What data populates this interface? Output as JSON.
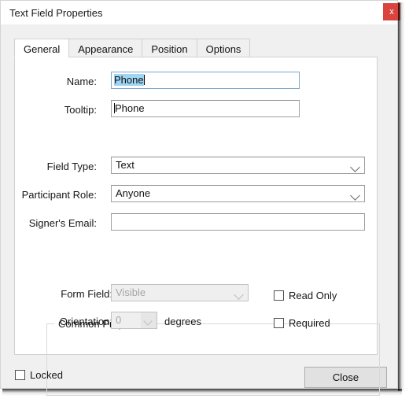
{
  "window": {
    "title": "Text Field Properties",
    "close_icon_label": "x",
    "close_icon_name": "close-icon",
    "accent_close_color": "#d9443f"
  },
  "tabs": [
    {
      "label": "General",
      "active": true
    },
    {
      "label": "Appearance",
      "active": false
    },
    {
      "label": "Position",
      "active": false
    },
    {
      "label": "Options",
      "active": false
    }
  ],
  "general": {
    "name_label": "Name:",
    "name_value": "Phone",
    "tooltip_label": "Tooltip:",
    "tooltip_value": "Phone",
    "field_type_label": "Field Type:",
    "field_type_value": "Text",
    "participant_role_label": "Participant Role:",
    "participant_role_value": "Anyone",
    "signers_email_label": "Signer's Email:",
    "signers_email_value": "",
    "signers_email_placeholder": ""
  },
  "common_properties": {
    "title": "Common Properties",
    "form_field_label": "Form Field:",
    "form_field_value": "Visible",
    "orientation_label": "Orientation:",
    "orientation_value": "0",
    "orientation_units": "degrees",
    "read_only_label": "Read Only",
    "read_only_checked": false,
    "required_label": "Required",
    "required_checked": false
  },
  "footer": {
    "locked_label": "Locked",
    "locked_checked": false,
    "close_label": "Close"
  }
}
